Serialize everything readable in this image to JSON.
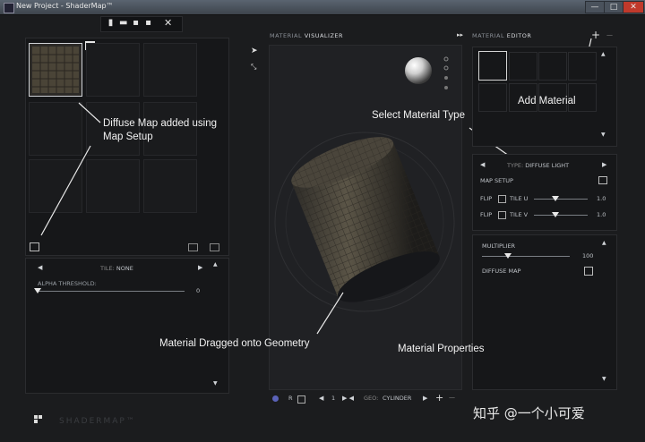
{
  "window": {
    "title": "New Project - ShaderMap™",
    "minimize": "—",
    "maximize": "□",
    "close": "✕"
  },
  "visualizer": {
    "header_dim": "MATERIAL",
    "header_bright": "VISUALIZER",
    "bottom": {
      "r_label": "R",
      "page_num": "1",
      "geo_label": "GEO:",
      "geo_value": "CYLINDER",
      "add": "+",
      "remove": "—"
    }
  },
  "material_editor": {
    "header_dim": "MATERIAL",
    "header_bright": "EDITOR",
    "add": "+",
    "remove": "—",
    "type_label": "TYPE:",
    "type_value": "DIFFUSE LIGHT",
    "map_setup": "MAP SETUP",
    "flip": "FLIP",
    "tile_u": "TILE U",
    "tile_u_value": "1.0",
    "tile_v": "TILE V",
    "tile_v_value": "1.0",
    "tile_u_level": 0.4,
    "tile_v_level": 0.4
  },
  "properties": {
    "multiplier": "MULTIPLIER",
    "multiplier_value": "100",
    "multiplier_level": 0.3,
    "diffuse_map": "DIFFUSE MAP"
  },
  "left": {
    "tile_label": "TILE:",
    "tile_value": "NONE",
    "alpha_threshold": "ALPHA THRESHOLD:",
    "alpha_value": "0",
    "alpha_level": 0.0
  },
  "annotations": {
    "diffuse_line1": "Diffuse Map added using",
    "diffuse_line2": "Map Setup",
    "select_type": "Select Material Type",
    "add_material": "Add Material",
    "dragged": "Material Dragged onto Geometry",
    "properties": "Material Properties"
  },
  "brand": "SHADERMAP™",
  "watermark": "知乎 @一个小可爱",
  "icon_names": [
    "new-file-icon",
    "open-folder-icon",
    "save-icon",
    "save-as-icon",
    "tools-icon",
    "pointer-icon",
    "move-icon",
    "back-arrow-icon",
    "image-icon",
    "trash-icon",
    "sphere-icon",
    "logo-icon"
  ]
}
